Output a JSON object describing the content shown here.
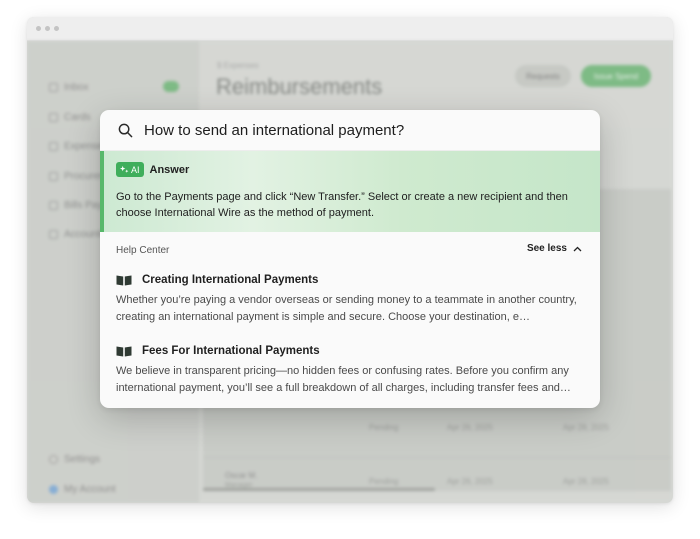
{
  "background_app": {
    "sidebar": {
      "items": [
        {
          "label": "Inbox",
          "icon": "inbox-icon"
        },
        {
          "label": "Cards",
          "icon": "card-icon"
        },
        {
          "label": "Expenses",
          "icon": "dollar-icon"
        },
        {
          "label": "Procurement",
          "icon": "cart-icon"
        },
        {
          "label": "Bills Pay",
          "icon": "bill-icon"
        },
        {
          "label": "Accounting",
          "icon": "ledger-icon"
        }
      ],
      "footer": [
        {
          "label": "Settings",
          "icon": "gear-icon"
        },
        {
          "label": "My Account",
          "icon": "avatar-icon"
        }
      ]
    },
    "breadcrumb": "$ Expenses",
    "title": "Reimbursements",
    "requests_button": "Requests",
    "primary_button": "Issue Spend",
    "rows": [
      {
        "name": "",
        "status": "Pending",
        "date": "Apr 26, 2025",
        "date2": "Apr 28, 2025"
      },
      {
        "name": "Oscar M.",
        "role": "Manager",
        "status": "Pending",
        "date": "Apr 26, 2025",
        "date2": "Apr 28, 2025"
      }
    ],
    "accent_color": "#5fb06a"
  },
  "search": {
    "query": "How to send an international payment?",
    "icon": "search-icon"
  },
  "answer": {
    "badge": "AI",
    "label": "Answer",
    "body": "Go to the Payments page and click “New Transfer.” Select or create a new recipient and then choose International Wire as the method of payment.",
    "accent_color": "#3fae5b"
  },
  "help_center": {
    "heading": "Help Center",
    "toggle": "See less",
    "articles": [
      {
        "title": "Creating International Payments",
        "snippet": "Whether you’re paying a vendor overseas or sending money to a teammate in another country, creating an international payment is simple and secure. Choose your destination, e…",
        "icon": "book-icon"
      },
      {
        "title": "Fees For International Payments",
        "snippet": "We believe in transparent pricing—no hidden fees or confusing rates. Before you confirm any international payment, you’ll see a full breakdown of all charges, including transfer fees and…",
        "icon": "book-icon"
      }
    ]
  }
}
